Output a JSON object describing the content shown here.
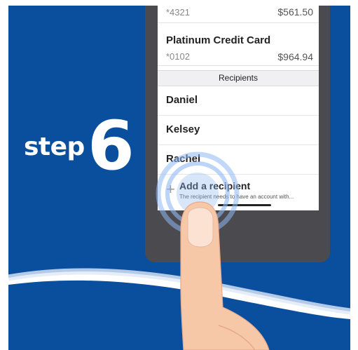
{
  "tutorial": {
    "step_word": "step",
    "step_number": "6"
  },
  "accounts": [
    {
      "name": "",
      "number": "*4321",
      "amount": "$561.50"
    },
    {
      "name": "Platinum Credit Card",
      "number": "*0102",
      "amount": "$964.94"
    }
  ],
  "recipients": {
    "header": "Recipients",
    "items": [
      {
        "label": "Daniel"
      },
      {
        "label": "Kelsey"
      },
      {
        "label": "Rachel"
      }
    ],
    "add": {
      "title": "Add a recipient",
      "hint": "The recipient needs to have an account with..."
    }
  },
  "icons": {
    "plus": "plus-icon",
    "touch": "touch-ripple-icon",
    "finger": "finger-illustration"
  },
  "colors": {
    "background": "#0a4f9e",
    "phone_frame": "#4b4b4f",
    "ripple": "#8fb8f2",
    "skin": "#f6c8a8"
  }
}
